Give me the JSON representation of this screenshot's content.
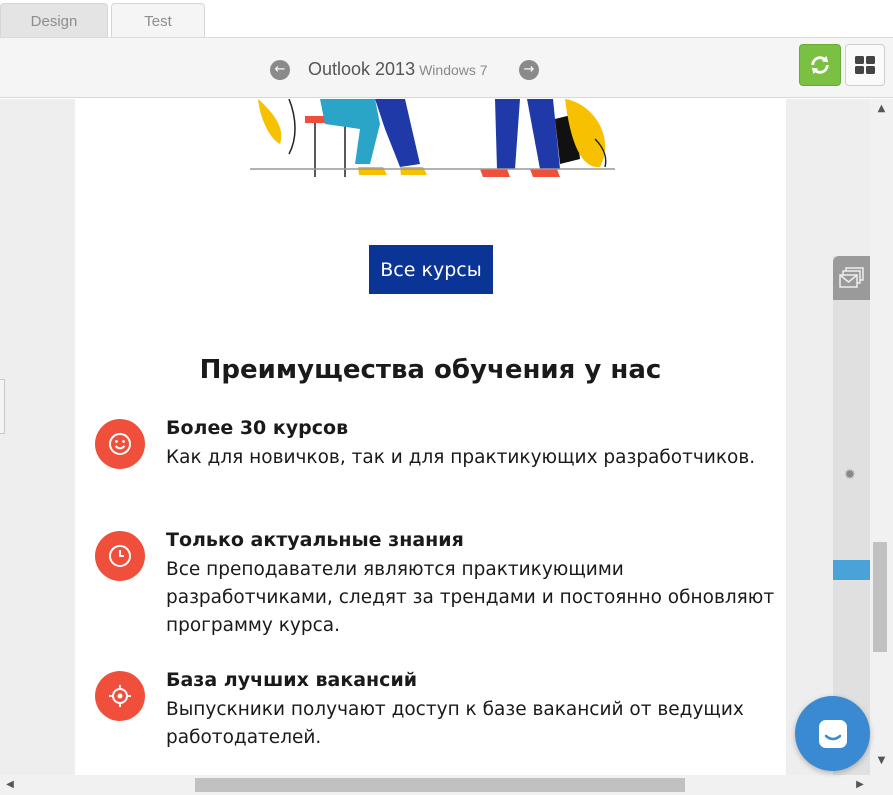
{
  "tabs": [
    {
      "label": "Design",
      "active": false
    },
    {
      "label": "Test",
      "active": true
    }
  ],
  "toolbar": {
    "client_name": "Outlook 2013",
    "client_os": "Windows 7",
    "prev_icon": "arrow-left-circle-icon",
    "next_icon": "arrow-right-circle-icon",
    "refresh_icon": "refresh-icon",
    "grid_icon": "grid-icon"
  },
  "email": {
    "cta_label": "Все курсы",
    "heading": "Преимущества обучения у нас",
    "benefits": [
      {
        "icon": "smile-icon",
        "title": "Более 30 курсов",
        "text": "Как для новичков, так и для практикующих разработчиков."
      },
      {
        "icon": "clock-icon",
        "title": "Только актуальные знания",
        "text": "Все преподаватели являются практикующими разработчиками, следят за трендами и постоянно обновляют программу курса."
      },
      {
        "icon": "target-icon",
        "title": "База лучших вакансий",
        "text": "Выпускники получают доступ к базе вакансий от ведущих работодателей."
      }
    ]
  },
  "colors": {
    "accent_green": "#7ac143",
    "cta_blue": "#0a3597",
    "icon_red": "#f04f3b",
    "chat_blue": "#3a8ad1",
    "panel_highlight": "#4aa3d8"
  }
}
